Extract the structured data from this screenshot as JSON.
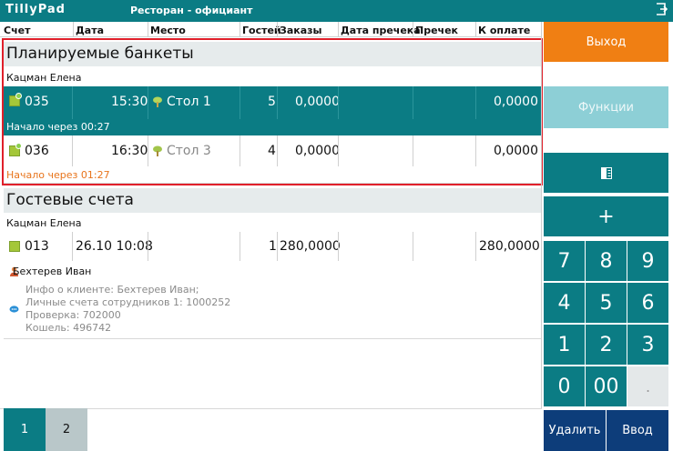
{
  "app": {
    "logo": "TillyPad",
    "title": "Ресторан - официант"
  },
  "columns": [
    "Счет",
    "Дата",
    "Место",
    "Гостей",
    "Заказы",
    "Дата пречека",
    "Пречек",
    "К оплате"
  ],
  "banquets": {
    "title": "Планируемые банкеты",
    "waiter": "Кацман Елена",
    "rows": [
      {
        "account": "035",
        "time": "15:30",
        "place": "Стол 1",
        "guests": "5",
        "orders": "0,0000",
        "to_pay": "0,0000",
        "note": "Начало через 00:27"
      },
      {
        "account": "036",
        "time": "16:30",
        "place": "Стол 3",
        "guests": "4",
        "orders": "0,0000",
        "to_pay": "0,0000",
        "note": "Начало через 01:27"
      }
    ]
  },
  "guest_bills": {
    "title": "Гостевые счета",
    "waiter": "Кацман Елена",
    "rows": [
      {
        "account": "013",
        "date": "26.10 10:08",
        "guests": "1",
        "orders": "280,0000",
        "to_pay": "280,0000"
      }
    ],
    "client_name": "Бехтерев Иван",
    "client_info": [
      "Инфо о клиенте: Бехтерев Иван;",
      "Личные счета сотрудников 1: 1000252",
      "Проверка: 702000",
      "Кошель: 496742"
    ]
  },
  "buttons": {
    "exit": "Выход",
    "functions": "Функции",
    "delete": "Удалить",
    "enter": "Ввод",
    "plus": "+",
    "split_icon": "split-view-icon"
  },
  "keypad": [
    "7",
    "8",
    "9",
    "4",
    "5",
    "6",
    "1",
    "2",
    "3",
    "0",
    "00",
    "."
  ],
  "pages": [
    "1",
    "2"
  ],
  "colors": {
    "teal": "#0b7c84",
    "orange": "#f07f13",
    "light_teal": "#8dcfd6",
    "navy": "#0d3d7a",
    "red_highlight": "#e0202b",
    "orange_note": "#e8741b"
  }
}
